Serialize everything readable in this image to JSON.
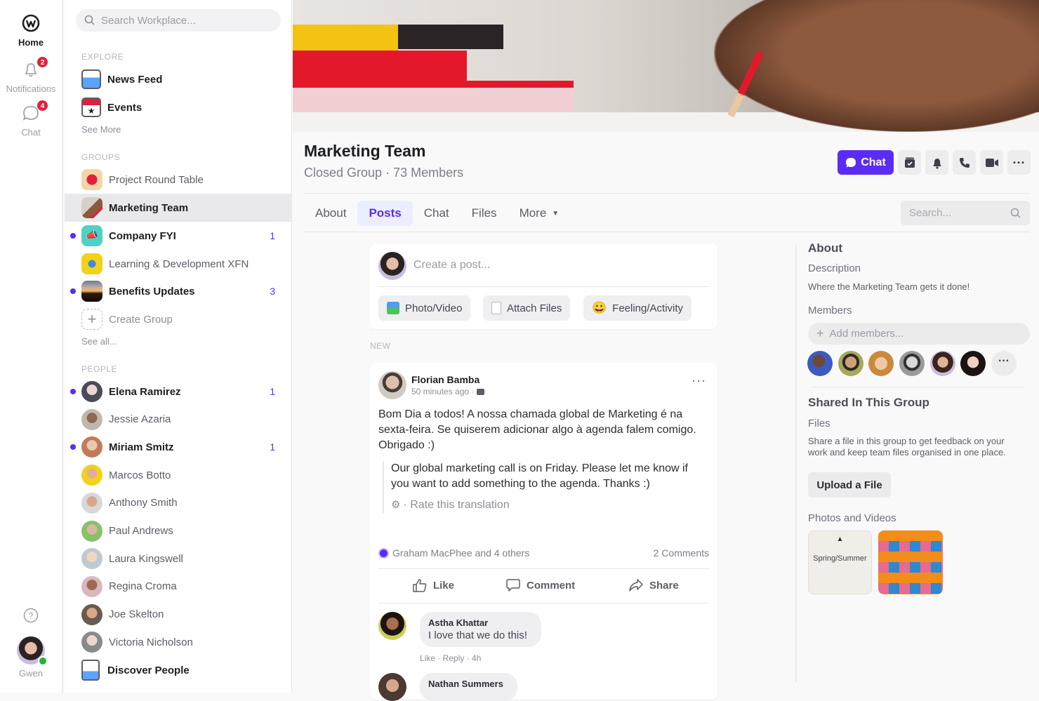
{
  "rail": {
    "home_label": "Home",
    "notifications_label": "Notifications",
    "notifications_badge": "2",
    "chat_label": "Chat",
    "chat_badge": "4",
    "user_label": "Gwen",
    "online_color": "#22b43a"
  },
  "sidebar": {
    "search_placeholder": "Search Workplace...",
    "explore_header": "EXPLORE",
    "explore": [
      {
        "label": "News Feed",
        "icon": "news-feed-icon"
      },
      {
        "label": "Events",
        "icon": "events-calendar-icon"
      }
    ],
    "explore_more": "See More",
    "groups_header": "GROUPS",
    "groups": [
      {
        "label": "Project Round Table",
        "unread": false,
        "count": "",
        "selected": false
      },
      {
        "label": "Marketing Team",
        "unread": false,
        "count": "",
        "selected": true
      },
      {
        "label": "Company FYI",
        "unread": true,
        "count": "1",
        "selected": false
      },
      {
        "label": "Learning & Development XFN",
        "unread": false,
        "count": "",
        "selected": false
      },
      {
        "label": "Benefits Updates",
        "unread": true,
        "count": "3",
        "selected": false
      }
    ],
    "create_group": "Create Group",
    "groups_more": "See all...",
    "people_header": "PEOPLE",
    "people": [
      {
        "label": "Elena Ramirez",
        "unread": true,
        "count": "1"
      },
      {
        "label": "Jessie Azaria",
        "unread": false,
        "count": ""
      },
      {
        "label": "Miriam Smitz",
        "unread": true,
        "count": "1"
      },
      {
        "label": "Marcos Botto",
        "unread": false,
        "count": ""
      },
      {
        "label": "Anthony Smith",
        "unread": false,
        "count": ""
      },
      {
        "label": "Paul Andrews",
        "unread": false,
        "count": ""
      },
      {
        "label": "Laura Kingswell",
        "unread": false,
        "count": ""
      },
      {
        "label": "Regina Croma",
        "unread": false,
        "count": ""
      },
      {
        "label": "Joe Skelton",
        "unread": false,
        "count": ""
      },
      {
        "label": "Victoria Nicholson",
        "unread": false,
        "count": ""
      }
    ],
    "discover_people": "Discover People",
    "accent_color": "#5b2cf5"
  },
  "group": {
    "title": "Marketing Team",
    "subtitle": "Closed Group · 73 Members",
    "chat_button": "Chat",
    "tabs": [
      {
        "label": "About",
        "active": false
      },
      {
        "label": "Posts",
        "active": true
      },
      {
        "label": "Chat",
        "active": false
      },
      {
        "label": "Files",
        "active": false
      },
      {
        "label": "More",
        "active": false
      }
    ],
    "search_placeholder": "Search..."
  },
  "composer": {
    "placeholder": "Create a post...",
    "photo_video": "Photo/Video",
    "attach_files": "Attach Files",
    "feeling": "Feeling/Activity"
  },
  "feed": {
    "new_label": "NEW",
    "post": {
      "author": "Florian Bamba",
      "time": "50 minutes ago ·",
      "body": "Bom Dia a todos! A nossa chamada global de Marketing é na sexta-feira. Se quiserem adicionar algo à agenda falem comigo. Obrigado :)",
      "translation": "Our global marketing call is on Friday. Please let me know if you want to add something to the agenda. Thanks :)",
      "rate_translation": "· Rate this translation",
      "likes": "Graham MacPhee and 4 others",
      "comments_count": "2 Comments",
      "like_label": "Like",
      "comment_label": "Comment",
      "share_label": "Share",
      "comments": [
        {
          "author": "Astha Khattar",
          "text": "I love that we do this!",
          "meta": "Like · Reply · 4h"
        },
        {
          "author": "Nathan Summers",
          "text": "",
          "meta": ""
        }
      ]
    }
  },
  "about": {
    "title": "About",
    "description_label": "Description",
    "description": "Where the Marketing Team gets it done!",
    "members_label": "Members",
    "add_members_placeholder": "Add members...",
    "shared_title": "Shared In This Group",
    "files_label": "Files",
    "files_text": "Share a file in this group to get feedback on your work and keep team files organised in one place.",
    "upload_button": "Upload a  File",
    "photos_label": "Photos and Videos",
    "photo1_caption": "Spring/Summer"
  }
}
